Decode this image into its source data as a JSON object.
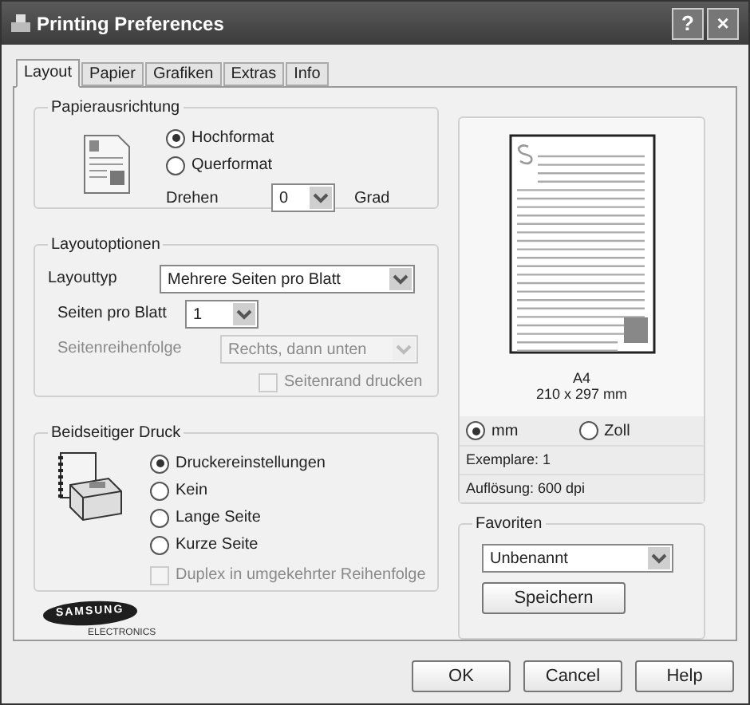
{
  "window": {
    "title": "Printing Preferences",
    "buttons": [
      "?",
      "×"
    ]
  },
  "tabs": [
    {
      "label": "Layout",
      "selected": true
    },
    {
      "label": "Papier",
      "selected": false
    },
    {
      "label": "Grafiken",
      "selected": false
    },
    {
      "label": "Extras",
      "selected": false
    },
    {
      "label": "Info",
      "selected": false
    }
  ],
  "orientation": {
    "title": "Papierausrichtung",
    "options": [
      {
        "label": "Hochformat",
        "selected": true
      },
      {
        "label": "Querformat",
        "selected": false
      }
    ],
    "rotate_label": "Drehen",
    "rotate_value": "0",
    "rotate_unit": "Grad"
  },
  "layout_options": {
    "title": "Layoutoptionen",
    "fields": [
      {
        "label": "Layouttyp",
        "value": "Mehrere Seiten pro Blatt",
        "disabled": false
      },
      {
        "label": "Seiten pro Blatt",
        "value": "1",
        "disabled": false
      },
      {
        "label": "Seitenreihenfolge",
        "value": "Rechts, dann unten",
        "disabled": true
      }
    ],
    "checkbox": {
      "label": "Seitenrand drucken",
      "checked": false,
      "disabled": true
    }
  },
  "duplex": {
    "title": "Beidseitiger Druck",
    "options": [
      {
        "label": "Druckereinstellungen",
        "selected": true
      },
      {
        "label": "Kein",
        "selected": false
      },
      {
        "label": "Lange Seite",
        "selected": false
      },
      {
        "label": "Kurze Seite",
        "selected": false
      }
    ],
    "checkbox": {
      "label": "Duplex in umgekehrter Reihenfolge",
      "checked": false,
      "disabled": true
    }
  },
  "logo": {
    "brand": "SAMSUNG",
    "sub": "ELECTRONICS"
  },
  "preview": {
    "paper": "A4",
    "size": "210 x 297 mm",
    "units": [
      {
        "label": "mm",
        "selected": true
      },
      {
        "label": "Zoll",
        "selected": false
      }
    ],
    "copies": "Exemplare: 1",
    "resolution": "Auflösung: 600 dpi"
  },
  "favorites": {
    "title": "Favoriten",
    "value": "Unbenannt",
    "save": "Speichern"
  },
  "buttons": [
    "OK",
    "Cancel",
    "Help"
  ]
}
